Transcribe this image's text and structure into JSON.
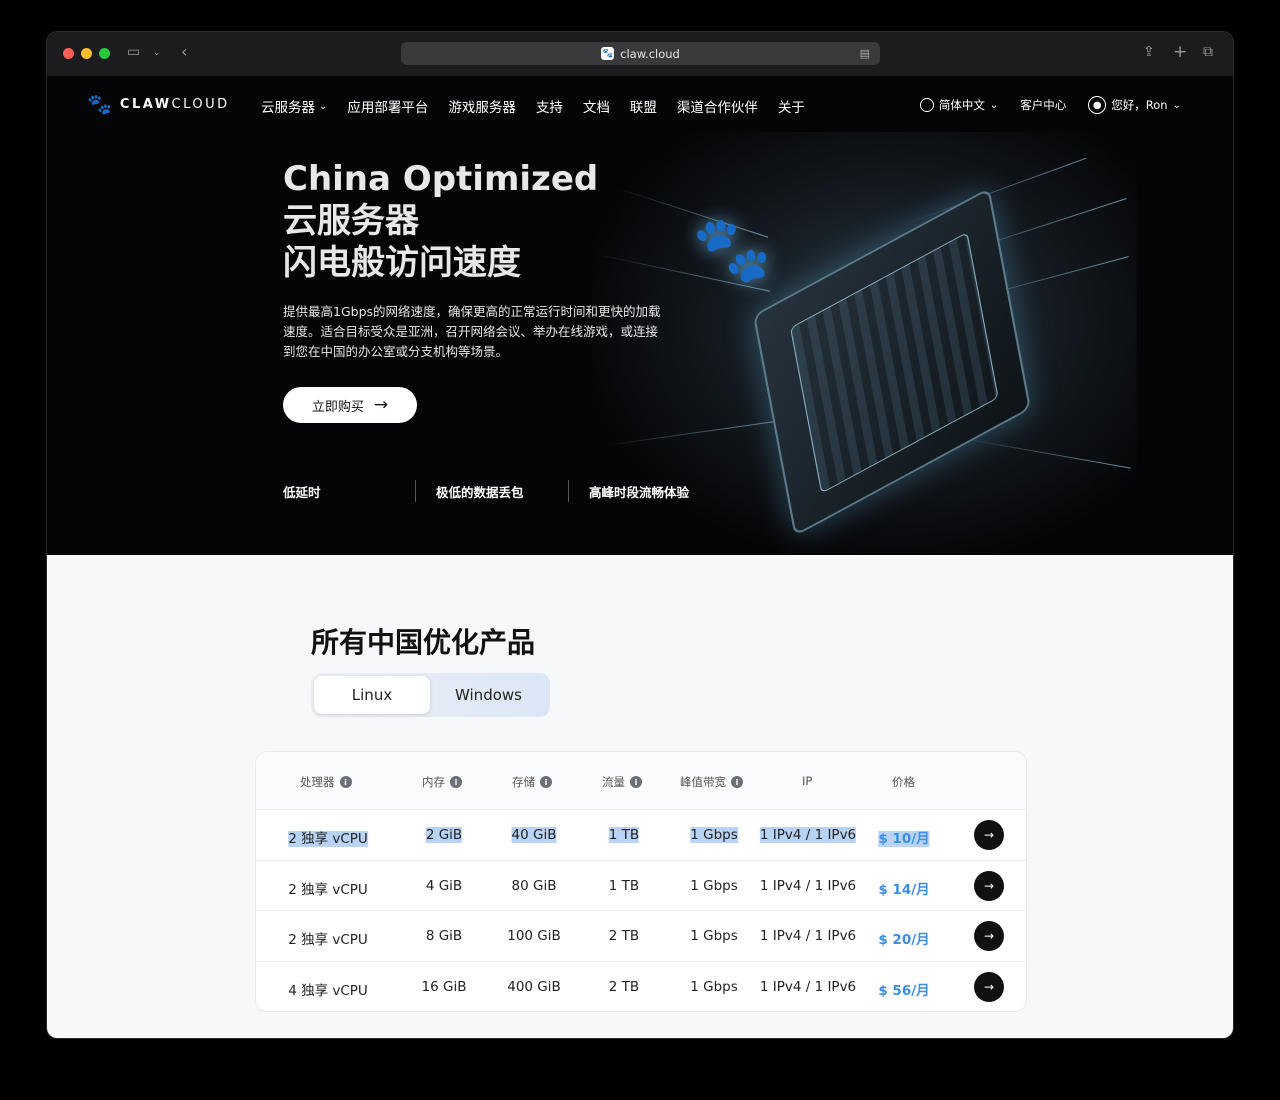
{
  "browser": {
    "url": "claw.cloud"
  },
  "nav": {
    "logo_bold": "CLAW",
    "logo_light": "CLOUD",
    "items": [
      {
        "label": "云服务器",
        "has_dropdown": true
      },
      {
        "label": "应用部署平台",
        "has_dropdown": false
      },
      {
        "label": "游戏服务器",
        "has_dropdown": false
      },
      {
        "label": "支持",
        "has_dropdown": false
      },
      {
        "label": "文档",
        "has_dropdown": false
      },
      {
        "label": "联盟",
        "has_dropdown": false
      },
      {
        "label": "渠道合作伙伴",
        "has_dropdown": false
      },
      {
        "label": "关于",
        "has_dropdown": false
      }
    ],
    "language": "简体中文",
    "customer_center": "客户中心",
    "greeting": "您好，Ron"
  },
  "hero": {
    "title_line1": "China Optimized",
    "title_line2": "云服务器",
    "title_line3": "闪电般访问速度",
    "description": "提供最高1Gbps的网络速度，确保更高的正常运行时间和更快的加载速度。适合目标受众是亚洲，召开网络会议、举办在线游戏，或连接到您在中国的办公室或分支机构等场景。",
    "buy_button": "立即购买",
    "features": [
      "低延时",
      "极低的数据丢包",
      "高峰时段流畅体验"
    ]
  },
  "products": {
    "title": "所有中国优化产品",
    "tabs": [
      {
        "label": "Linux",
        "active": true
      },
      {
        "label": "Windows",
        "active": false
      }
    ],
    "columns": [
      {
        "label": "处理器",
        "info": true
      },
      {
        "label": "内存",
        "info": true
      },
      {
        "label": "存储",
        "info": true
      },
      {
        "label": "流量",
        "info": true
      },
      {
        "label": "峰值带宽",
        "info": true
      },
      {
        "label": "IP",
        "info": false
      },
      {
        "label": "价格",
        "info": false
      }
    ],
    "rows": [
      {
        "cpu": "2 独享 vCPU",
        "memory": "2 GiB",
        "storage": "40 GiB",
        "traffic": "1 TB",
        "bandwidth": "1 Gbps",
        "ip": "1 IPv4 / 1 IPv6",
        "price": "$ 10/月",
        "selected": true
      },
      {
        "cpu": "2 独享 vCPU",
        "memory": "4 GiB",
        "storage": "80 GiB",
        "traffic": "1 TB",
        "bandwidth": "1 Gbps",
        "ip": "1 IPv4 / 1 IPv6",
        "price": "$ 14/月",
        "selected": false
      },
      {
        "cpu": "2 独享 vCPU",
        "memory": "8 GiB",
        "storage": "100 GiB",
        "traffic": "2 TB",
        "bandwidth": "1 Gbps",
        "ip": "1 IPv4 / 1 IPv6",
        "price": "$ 20/月",
        "selected": false
      },
      {
        "cpu": "4 独享 vCPU",
        "memory": "16 GiB",
        "storage": "400 GiB",
        "traffic": "2 TB",
        "bandwidth": "1 Gbps",
        "ip": "1 IPv4 / 1 IPv6",
        "price": "$ 56/月",
        "selected": false
      }
    ]
  },
  "icons": {
    "logo": "paw-icon",
    "language": "globe-icon",
    "account": "user-icon",
    "row_action": "arrow-right-icon"
  },
  "colors": {
    "price": "#3b8de6",
    "selection": "#b9d3f5",
    "hero_bg": "#050507"
  }
}
